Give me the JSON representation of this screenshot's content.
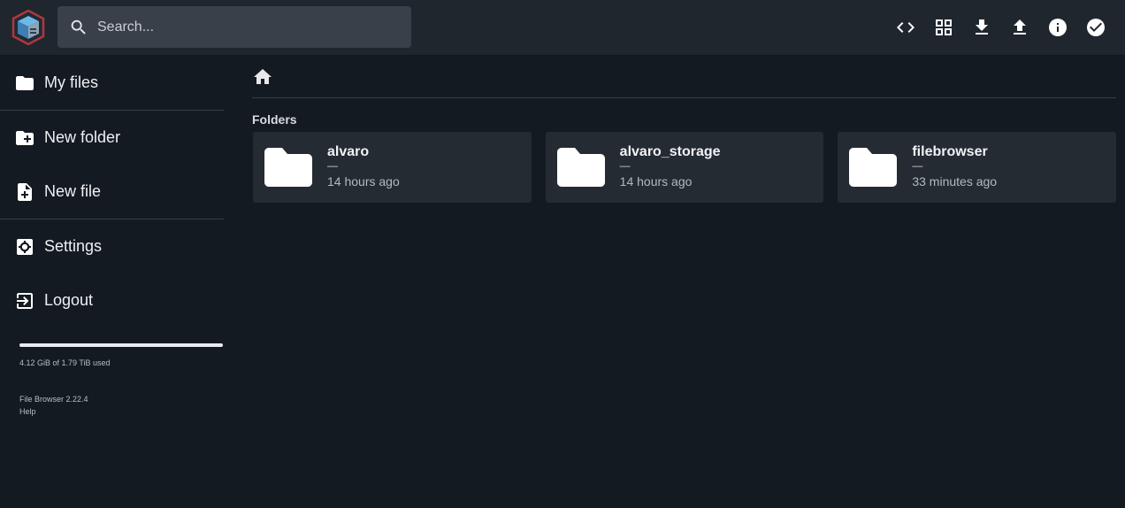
{
  "search": {
    "placeholder": "Search..."
  },
  "toolbar": {
    "icons": [
      "code-icon",
      "grid-view-icon",
      "download-icon",
      "upload-icon",
      "info-icon",
      "check-circle-icon"
    ]
  },
  "sidebar": {
    "items": [
      {
        "label": "My files",
        "icon": "folder-icon"
      },
      {
        "label": "New folder",
        "icon": "new-folder-icon"
      },
      {
        "label": "New file",
        "icon": "new-file-icon"
      },
      {
        "label": "Settings",
        "icon": "settings-icon"
      },
      {
        "label": "Logout",
        "icon": "logout-icon"
      }
    ],
    "usage": {
      "text": "4.12 GiB of 1.79 TiB used"
    },
    "footer": {
      "version": "File Browser 2.22.4",
      "help": "Help"
    }
  },
  "main": {
    "section_title": "Folders",
    "folders": [
      {
        "name": "alvaro",
        "size": "—",
        "modified": "14 hours ago"
      },
      {
        "name": "alvaro_storage",
        "size": "—",
        "modified": "14 hours ago"
      },
      {
        "name": "filebrowser",
        "size": "—",
        "modified": "33 minutes ago"
      }
    ]
  },
  "colors": {
    "background": "#141a22",
    "topbar": "#20262e",
    "card": "#252b33",
    "search": "#39404a"
  }
}
